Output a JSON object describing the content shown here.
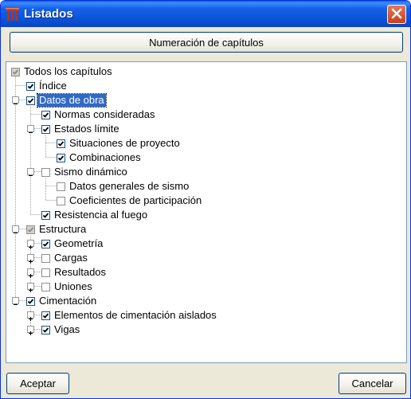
{
  "window": {
    "title": "Listados"
  },
  "buttons": {
    "numeracion": "Numeración de capítulos",
    "aceptar": "Aceptar",
    "cancelar": "Cancelar"
  },
  "tree": {
    "root": "Todos los capítulos",
    "indice": "Índice",
    "datos_obra": "Datos de obra",
    "normas": "Normas consideradas",
    "estados_limite": "Estados límite",
    "situaciones": "Situaciones de proyecto",
    "combinaciones": "Combinaciones",
    "sismo": "Sismo dinámico",
    "datos_sismo": "Datos generales de sismo",
    "coeficientes": "Coeficientes de participación",
    "resistencia": "Resistencia al fuego",
    "estructura": "Estructura",
    "geometria": "Geometría",
    "cargas": "Cargas",
    "resultados": "Resultados",
    "uniones": "Uniones",
    "cimentacion": "Cimentación",
    "elementos": "Elementos de cimentación aislados",
    "vigas": "Vigas"
  },
  "colors": {
    "titlebar": "#0b53d6",
    "selection": "#316ac5",
    "check": "#21a121"
  },
  "icons": [
    "app-icon",
    "close-icon",
    "checkbox",
    "expander-minus",
    "expander-plus"
  ]
}
